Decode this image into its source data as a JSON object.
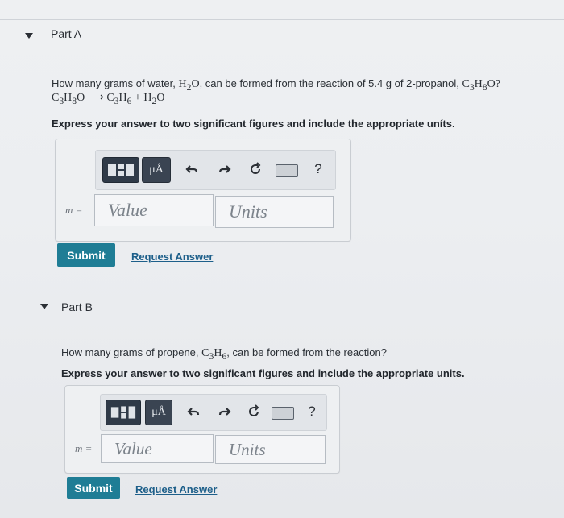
{
  "partA": {
    "title": "Part A",
    "question_text": "How many grams of water, ",
    "q_water": "H",
    "q_water_sub": "2",
    "q_water_end": "O",
    "q_mid": ", can be formed from the reaction of 5.4 g of 2-propanol, ",
    "q_prop": "C",
    "q_prop_sub1": "3",
    "q_prop_h": "H",
    "q_prop_sub2": "8",
    "q_prop_end": "O?",
    "eq_left": "C",
    "eq_left_sub1": "3",
    "eq_left_h": "H",
    "eq_left_sub2": "8",
    "eq_left_o": "O",
    "eq_arrow": "⟶",
    "eq_c": "C",
    "eq_c_sub": "3",
    "eq_h": "H",
    "eq_h_sub": "6",
    "eq_plus": "+",
    "eq_w": "H",
    "eq_w_sub": "2",
    "eq_w_o": "O",
    "instruction": "Express your answer to two significant figures and include the appropriate uníts.",
    "var_label": "m =",
    "value_placeholder": "Value",
    "units_placeholder": "Units",
    "submit": "Submit",
    "request": "Request Answer"
  },
  "partB": {
    "title": "Part B",
    "question_pre": "How many grams of propene, ",
    "q_c": "C",
    "q_c_sub": "3",
    "q_h": "H",
    "q_h_sub": "6",
    "question_post": ", can be formed from the reaction?",
    "instruction": "Express your answer to two significant figures and include the appropriate units.",
    "var_label": "m =",
    "value_placeholder": "Value",
    "units_placeholder": "Units",
    "submit": "Submit",
    "request": "Request Answer"
  },
  "toolbar": {
    "units_glyph": "μÅ",
    "help": "?"
  }
}
